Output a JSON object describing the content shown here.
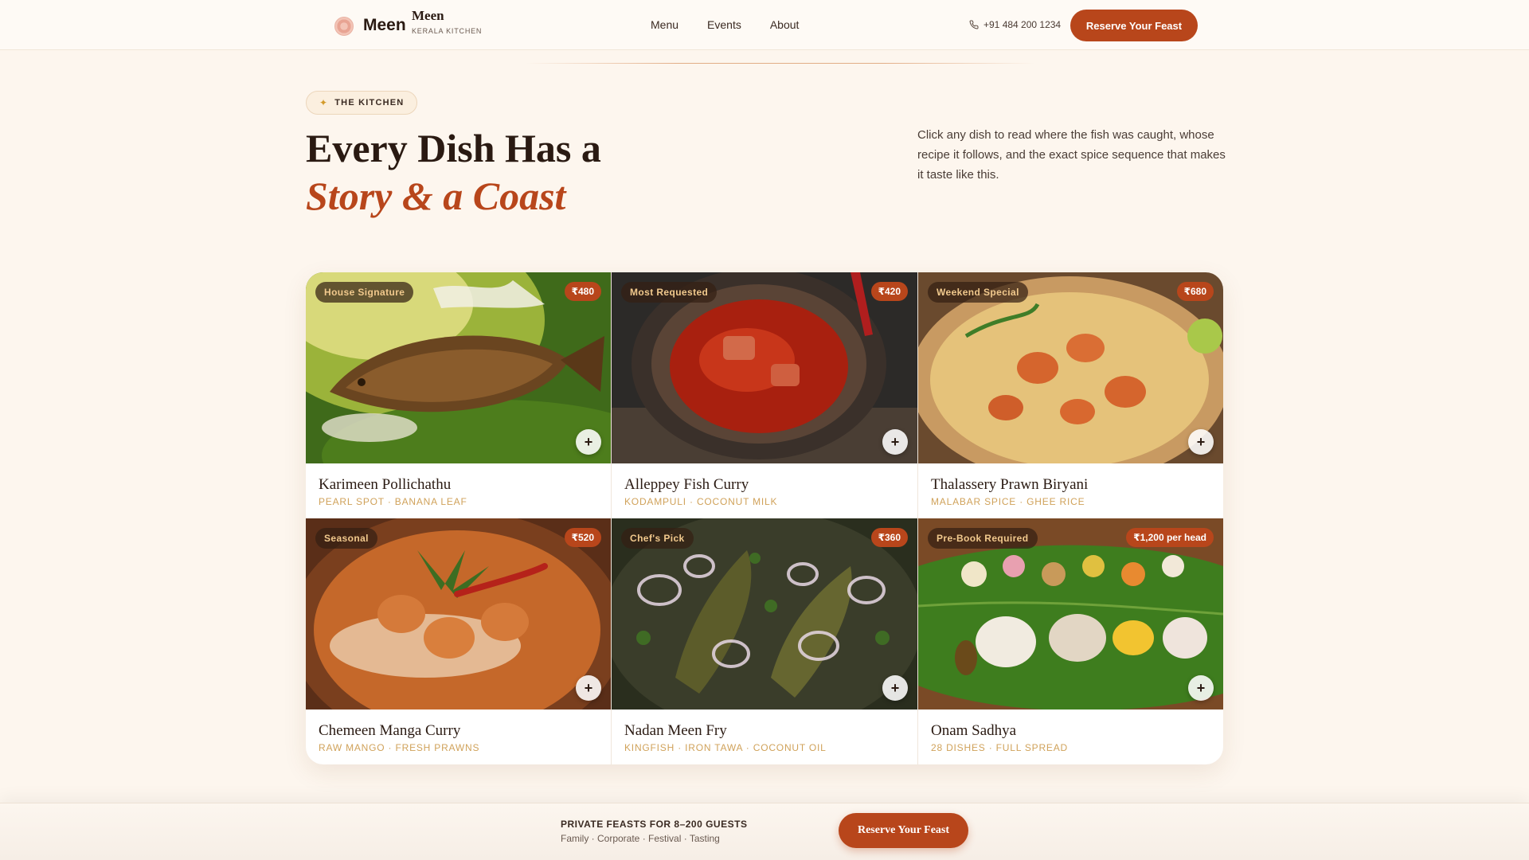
{
  "header": {
    "logo_name": "Meen",
    "brand_title": "Meen",
    "brand_subtitle": "KERALA KITCHEN",
    "nav": [
      "Menu",
      "Events",
      "About"
    ],
    "phone": "+91 484 200 1234",
    "cta": "Reserve Your Feast"
  },
  "hero": {
    "pill": "THE KITCHEN",
    "title_line1": "Every Dish Has a",
    "title_line2": "Story & a Coast",
    "description": "Click any dish to read where the fish was caught, whose recipe it follows, and the exact spice sequence that makes it taste like this."
  },
  "dishes": [
    {
      "tag": "House Signature",
      "price": "₹480",
      "name": "Karimeen Pollichathu",
      "meta": "PEARL SPOT · BANANA LEAF",
      "image": "fried-fish-on-banana-leaf"
    },
    {
      "tag": "Most Requested",
      "price": "₹420",
      "name": "Alleppey Fish Curry",
      "meta": "KODAMPULI · COCONUT MILK",
      "image": "red-fish-curry-in-clay-pot"
    },
    {
      "tag": "Weekend Special",
      "price": "₹680",
      "name": "Thalassery Prawn Biryani",
      "meta": "MALABAR SPICE · GHEE RICE",
      "image": "prawn-biryani-plate"
    },
    {
      "tag": "Seasonal",
      "price": "₹520",
      "name": "Chemeen Manga Curry",
      "meta": "RAW MANGO · FRESH PRAWNS",
      "image": "prawn-mango-curry-bowl"
    },
    {
      "tag": "Chef's Pick",
      "price": "₹360",
      "name": "Nadan Meen Fry",
      "meta": "KINGFISH · IRON TAWA · COCONUT OIL",
      "image": "fried-fish-with-onions"
    },
    {
      "tag": "Pre-Book Required",
      "price": "₹1,200 per head",
      "name": "Onam Sadhya",
      "meta": "28 DISHES · FULL SPREAD",
      "image": "sadhya-feast-on-banana-leaf"
    }
  ],
  "bottom_bar": {
    "title": "PRIVATE FEASTS FOR 8–200 GUESTS",
    "subtitle": "Family · Corporate · Festival · Tasting",
    "cta": "Reserve Your Feast"
  },
  "colors": {
    "accent": "#b8461b",
    "background": "#fdf6ee",
    "meta_gold": "#d0a25a"
  }
}
